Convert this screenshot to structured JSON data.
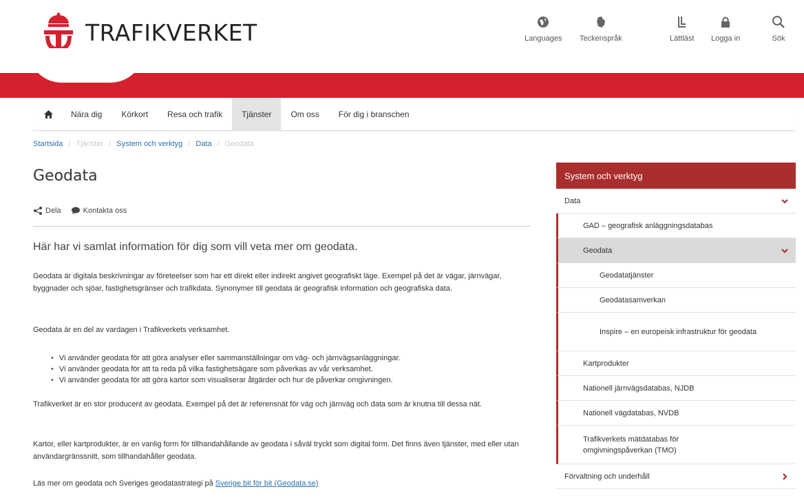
{
  "brand": {
    "name": "TRAFIKVERKET"
  },
  "utility": [
    {
      "label": "Languages",
      "icon": "globe-icon"
    },
    {
      "label": "Teckenspråk",
      "icon": "sign-language-icon"
    },
    {
      "label": "Lättläst",
      "icon": "easy-read-icon"
    },
    {
      "label": "Logga in",
      "icon": "lock-icon"
    },
    {
      "label": "Sök",
      "icon": "search-icon"
    }
  ],
  "nav": {
    "home_icon": "home-icon",
    "items": [
      "Nära dig",
      "Körkort",
      "Resa och trafik",
      "Tjänster",
      "Om oss",
      "För dig i branschen"
    ],
    "active": "Tjänster"
  },
  "breadcrumb": {
    "items": [
      "Startsida",
      "Tjänster",
      "System och verktyg",
      "Data",
      "Geodata"
    ]
  },
  "page": {
    "title": "Geodata",
    "share_label": "Dela",
    "contact_label": "Kontakta oss",
    "lead": "Här har vi samlat information för dig som vill veta mer om geodata.",
    "p1": "Geodata är digitala beskrivningar av företeelser som har ett direkt eller indirekt angivet geografiskt läge. Exempel på det är vägar, järnvägar, byggnader och sjöar, fastighetsgränser och trafikdata. Synonymer till geodata är geografisk information och geografiska data.",
    "p2": "Geodata är en del av vardagen i Trafikverkets verksamhet.",
    "bullets": [
      "Vi använder geodata för att göra analyser eller sammanställningar om väg- och järnvägsanläggningar.",
      "Vi använder geodata för att ta reda på vilka fastighetsägare som påverkas av vår verksamhet.",
      "Vi använder geodata för att göra kartor som visualiserar åtgärder och hur de påverkar omgivningen."
    ],
    "p3": "Trafikverket är en stor producent av geodata. Exempel på det är referensnät för väg och järnväg och data som är knutna till dessa nät.",
    "p4": "Kartor, eller kartprodukter, är en vanlig form för tillhandahållande av geodata i såväl tryckt som digital form. Det finns även tjänster, med eller utan användargränssnitt, som tillhandahåller geodata.",
    "p5_prefix": "Läs mer om geodata och Sveriges geodatastrategi på ",
    "p5_link": "Sverige bit för bit (Geodata.se)"
  },
  "sidebar": {
    "heading": "System och verktyg",
    "items": [
      {
        "label": "Data"
      },
      {
        "label": "GAD – geografisk anläggningsdatabas"
      },
      {
        "label": "Geodata"
      },
      {
        "label": "Geodatatjänster"
      },
      {
        "label": "Geodatasamverkan"
      },
      {
        "label": "Inspire – en europeisk infrastruktur för geodata"
      },
      {
        "label": "Kartprodukter"
      },
      {
        "label": "Nationell järnvägsdatabas, NJDB"
      },
      {
        "label": "Nationell vägdatabas, NVDB"
      },
      {
        "label": "Trafikverkets mätdatabas för omgivningspåverkan (TMO)"
      },
      {
        "label": "Förvaltning och underhåll"
      }
    ]
  },
  "colors": {
    "brand_red": "#d5202e",
    "sidebar_red": "#ab2e2e",
    "link": "#2a72a8"
  }
}
